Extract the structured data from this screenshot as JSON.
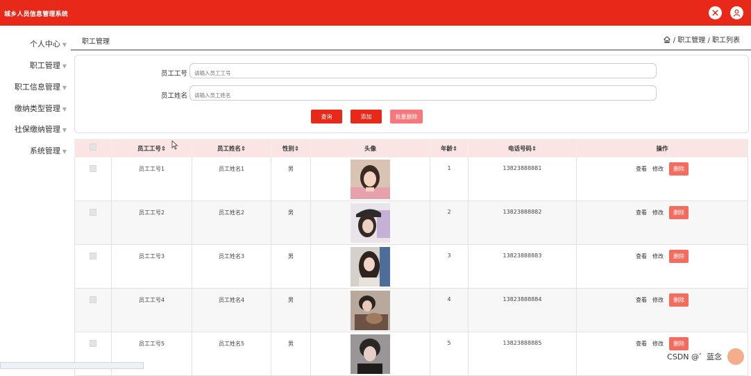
{
  "app": {
    "title": "城乡人员信息管理系统"
  },
  "topbar_icons": [
    "fullscreen-toggle-icon",
    "user-avatar-icon"
  ],
  "sidebar": {
    "items": [
      {
        "label": "个人中心"
      },
      {
        "label": "职工管理"
      },
      {
        "label": "职工信息管理"
      },
      {
        "label": "缴纳类型管理"
      },
      {
        "label": "社保缴纳管理"
      },
      {
        "label": "系统管理"
      }
    ]
  },
  "breadcrumb": {
    "page_title": "职工管理",
    "path": "/ 职工管理 / 职工列表"
  },
  "filters": {
    "emp_no_label": "员工工号",
    "emp_no_placeholder": "请输入员工工号",
    "emp_name_label": "员工姓名",
    "emp_name_placeholder": "请输入员工姓名",
    "query_button": "查询",
    "add_button": "添加",
    "batch_delete_button": "批量删除"
  },
  "table": {
    "headers": [
      "员工工号⇕",
      "员工姓名⇕",
      "性别⇕",
      "头像",
      "年龄⇕",
      "电话号码⇕",
      "操作"
    ],
    "rows": [
      {
        "emp_no": "员工工号1",
        "name": "员工姓名1",
        "gender": "男",
        "age": "1",
        "phone": "13823888881"
      },
      {
        "emp_no": "员工工号2",
        "name": "员工姓名2",
        "gender": "男",
        "age": "2",
        "phone": "13823888882"
      },
      {
        "emp_no": "员工工号3",
        "name": "员工姓名3",
        "gender": "男",
        "age": "3",
        "phone": "13823888883"
      },
      {
        "emp_no": "员工工号4",
        "name": "员工姓名4",
        "gender": "男",
        "age": "4",
        "phone": "13823888884"
      },
      {
        "emp_no": "员工工号5",
        "name": "员工姓名5",
        "gender": "男",
        "age": "5",
        "phone": "13823888885"
      }
    ],
    "actions": {
      "view": "查看",
      "edit": "修改",
      "delete": "删除"
    }
  },
  "watermark": "CSDN @゛蓝念",
  "colors": {
    "primary": "#e8291a",
    "header_bg": "#fae5e4",
    "batch_delete": "#f8777a",
    "delete": "#f56c5f"
  }
}
